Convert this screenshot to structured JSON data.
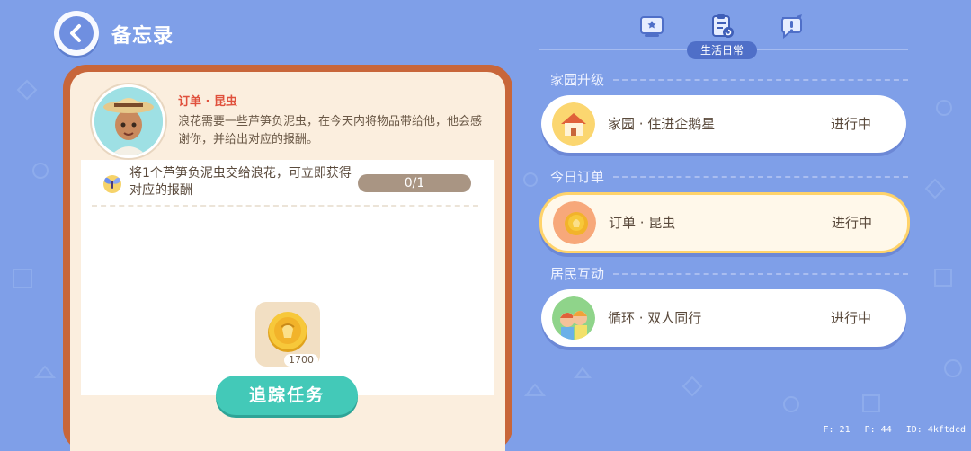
{
  "header": {
    "title": "备忘录"
  },
  "order": {
    "title": "订单 · 昆虫",
    "description": "浪花需要一些芦笋负泥虫，在今天内将物品带给他，他会感谢你，并给出对应的报酬。",
    "task_text": "将1个芦笋负泥虫交给浪花，可立即获得对应的报酬",
    "progress": "0/1",
    "progress_fraction": 0,
    "reward_count": "1700",
    "track_label": "追踪任务"
  },
  "tabs": {
    "active_label": "生活日常"
  },
  "sections": [
    {
      "title": "家园升级",
      "quest": {
        "name": "家园 · 住进企鹅星",
        "status": "进行中",
        "icon": "house-icon"
      }
    },
    {
      "title": "今日订单",
      "quest": {
        "name": "订单 · 昆虫",
        "status": "进行中",
        "icon": "coin-icon"
      }
    },
    {
      "title": "居民互动",
      "quest": {
        "name": "循环 · 双人同行",
        "status": "进行中",
        "icon": "two-residents-icon"
      }
    }
  ],
  "debug": {
    "f": "F: 21",
    "p": "P: 44",
    "id": "ID: 4kftdcd"
  },
  "colors": {
    "background": "#7f9fe8",
    "card_frame": "#c8663a",
    "button": "#43c9b8",
    "accent_red": "#e0513d"
  }
}
